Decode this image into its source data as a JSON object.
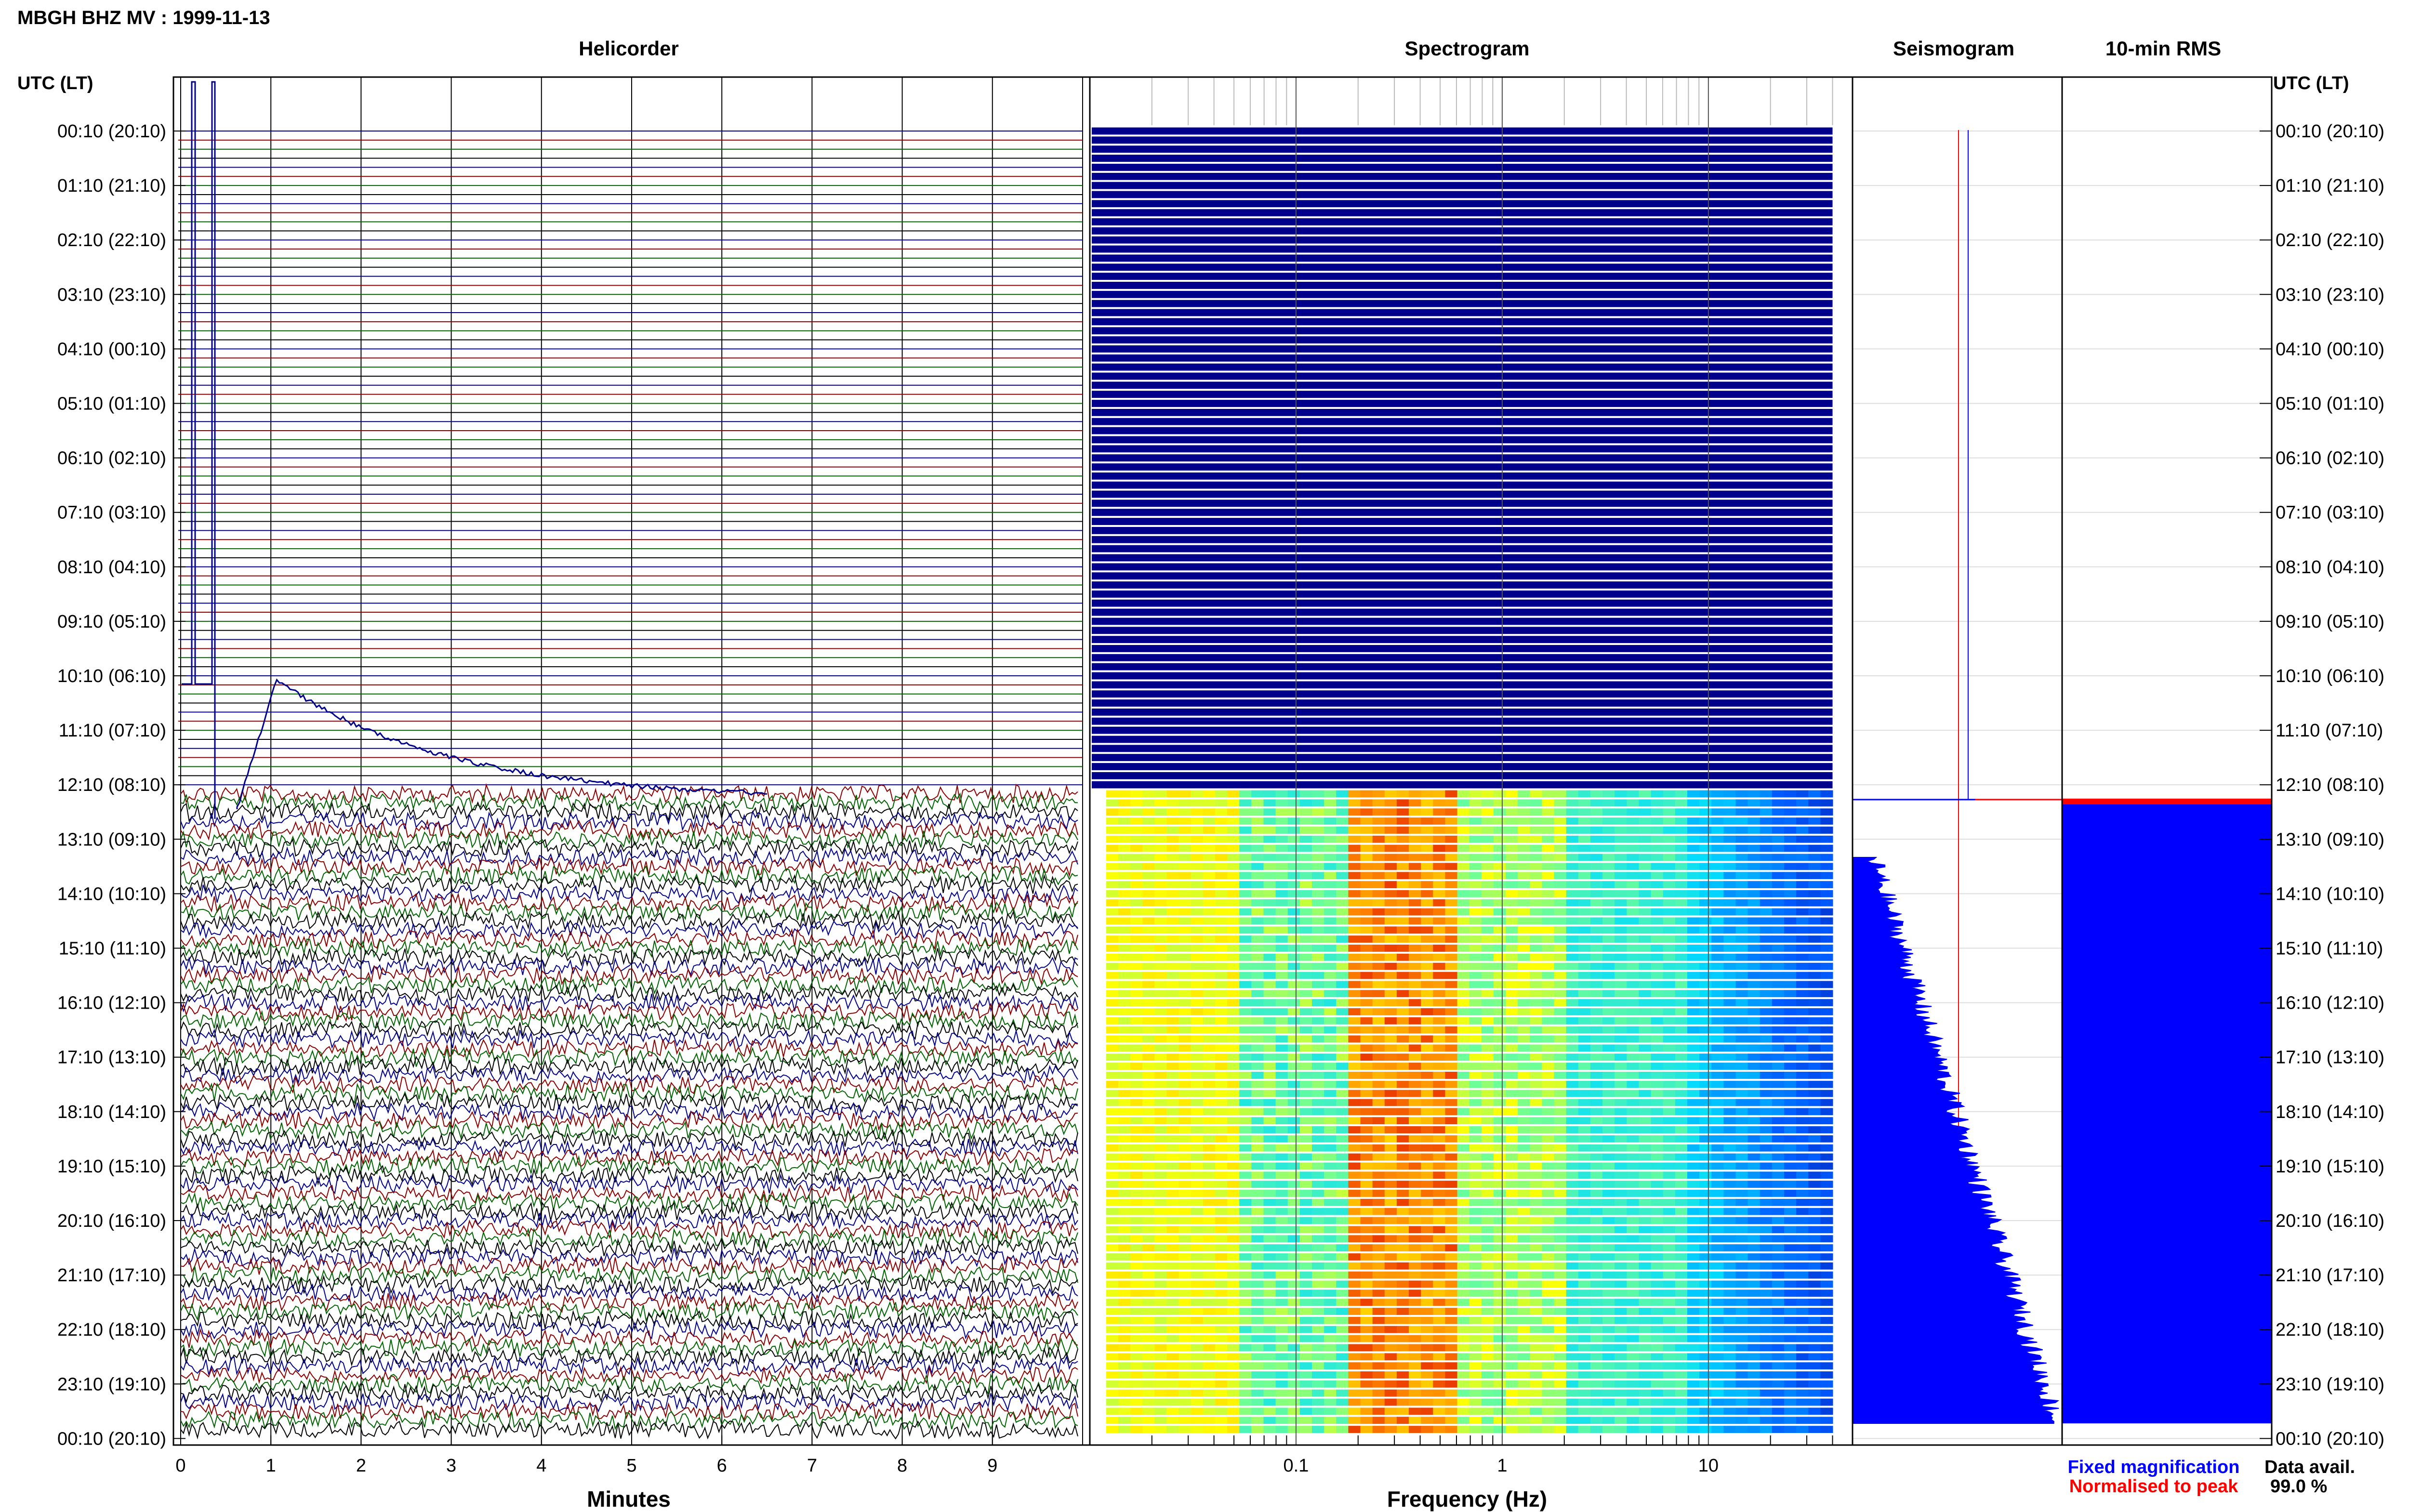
{
  "header": {
    "title": "MBGH BHZ MV : 1999-11-13",
    "utc_label_left": "UTC (LT)",
    "utc_label_right": "UTC (LT)"
  },
  "panels": {
    "helicorder_title": "Helicorder",
    "spectrogram_title": "Spectrogram",
    "seismogram_title": "Seismogram",
    "rms_title": "10-min RMS"
  },
  "footer": {
    "minutes_label": "Minutes",
    "frequency_label": "Frequency (Hz)",
    "legend_fixed": "Fixed magnification",
    "legend_normalised": "Normalised to peak",
    "data_avail_label": "Data avail.",
    "data_avail_value": "99.0 %"
  },
  "colors": {
    "fixed": "#0000ff",
    "normalised": "#ff0000",
    "trace_blue": "#00008b",
    "trace_red": "#8b0000",
    "trace_green": "#006400",
    "trace_black": "#000000",
    "spectro_empty": "#00008b",
    "rms_fill": "#0000ff"
  },
  "chart_data": {
    "type": "helicorder",
    "time_labels": [
      "00:10 (20:10)",
      "01:10 (21:10)",
      "02:10 (22:10)",
      "03:10 (23:10)",
      "04:10 (00:10)",
      "05:10 (01:10)",
      "06:10 (02:10)",
      "07:10 (03:10)",
      "08:10 (04:10)",
      "09:10 (05:10)",
      "10:10 (06:10)",
      "11:10 (07:10)",
      "12:10 (08:10)",
      "13:10 (09:10)",
      "14:10 (10:10)",
      "15:10 (11:10)",
      "16:10 (12:10)",
      "17:10 (13:10)",
      "18:10 (14:10)",
      "19:10 (15:10)",
      "20:10 (16:10)",
      "21:10 (17:10)",
      "22:10 (18:10)",
      "23:10 (19:10)",
      "00:10 (20:10)"
    ],
    "minutes_ticks": [
      "0",
      "1",
      "2",
      "3",
      "4",
      "5",
      "6",
      "7",
      "8",
      "9"
    ],
    "minutes_range": [
      0,
      10
    ],
    "frequency_ticks": [
      "0.1",
      "1",
      "10"
    ],
    "frequency_range_hz": [
      0.01,
      50
    ],
    "rows": 144,
    "data_start_row": 73,
    "data_end_row": 143
  }
}
